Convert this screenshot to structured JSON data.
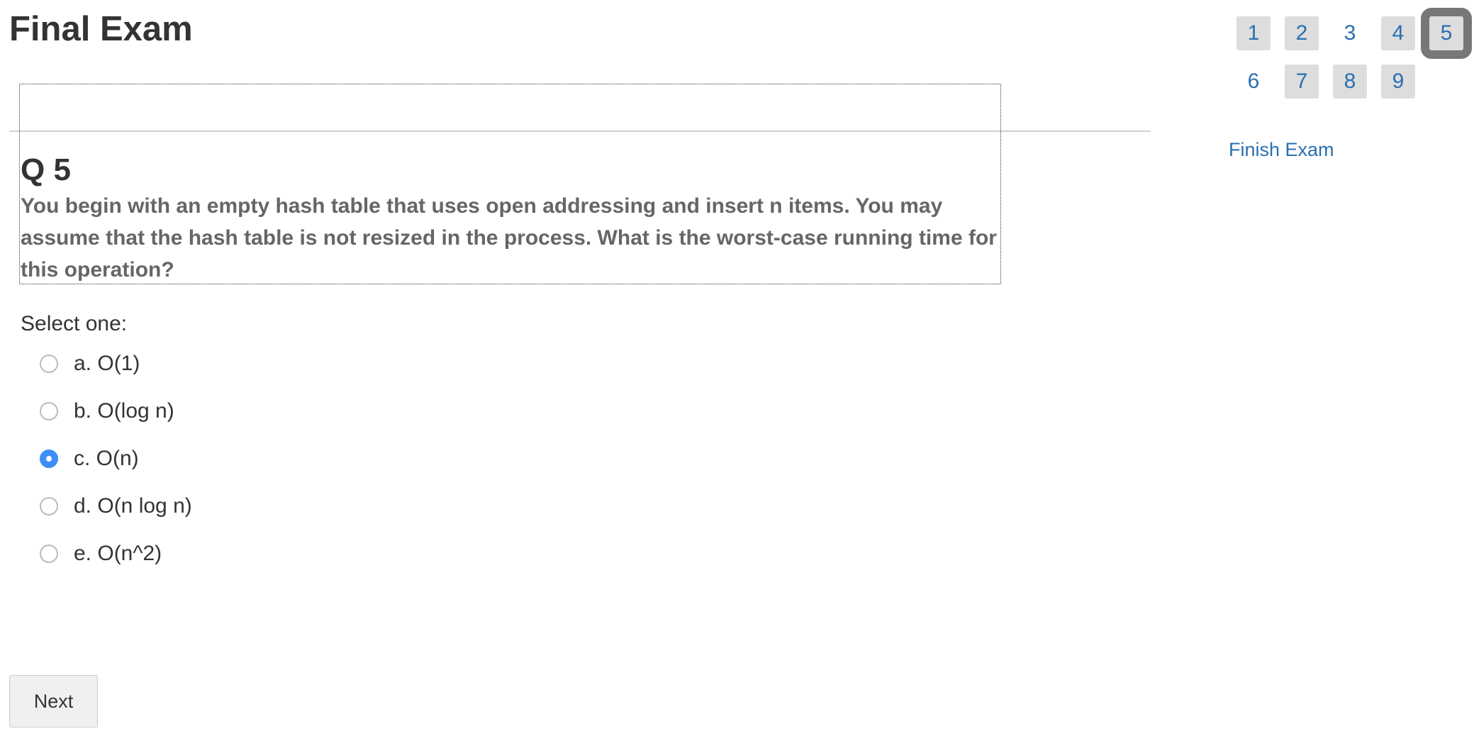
{
  "exam": {
    "title": "Final Exam"
  },
  "question": {
    "number_label": "Q 5",
    "text": "You begin with an empty hash table that uses open addressing and insert n items. You may assume that the hash table is not resized in the process. What is the worst-case running time for this operation?",
    "select_label": "Select one:",
    "options": [
      {
        "label": "a. O(1)",
        "selected": false
      },
      {
        "label": "b. O(log n)",
        "selected": false
      },
      {
        "label": "c. O(n)",
        "selected": true
      },
      {
        "label": "d. O(n log n)",
        "selected": false
      },
      {
        "label": "e. O(n^2)",
        "selected": false
      }
    ]
  },
  "footer": {
    "next_label": "Next"
  },
  "navigation": {
    "items": [
      {
        "label": "1",
        "state": "answered"
      },
      {
        "label": "2",
        "state": "answered"
      },
      {
        "label": "3",
        "state": "unanswered"
      },
      {
        "label": "4",
        "state": "answered"
      },
      {
        "label": "5",
        "state": "current"
      },
      {
        "label": "6",
        "state": "unanswered"
      },
      {
        "label": "7",
        "state": "answered"
      },
      {
        "label": "8",
        "state": "answered"
      },
      {
        "label": "9",
        "state": "answered"
      }
    ],
    "finish_label": "Finish Exam"
  },
  "colors": {
    "link": "#2a6fb0",
    "radio_selected": "#3b8ef5",
    "nav_answered_bg": "#dddddd",
    "nav_current_outline": "#777777"
  }
}
